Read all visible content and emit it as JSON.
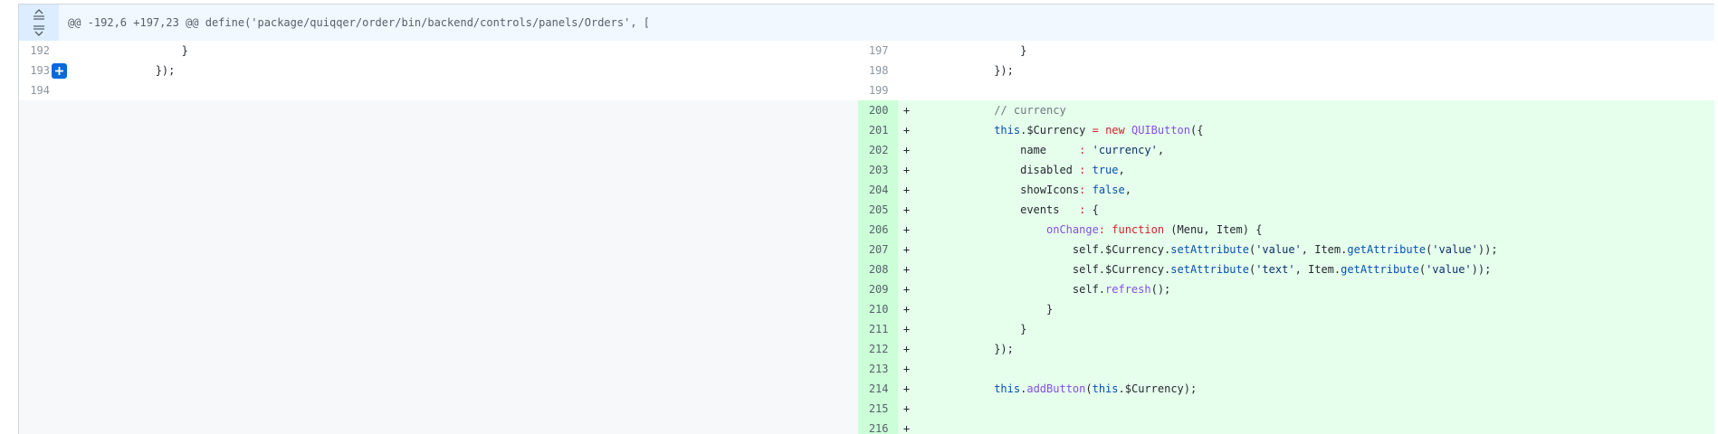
{
  "hunk": {
    "header": "@@ -192,6 +197,23 @@ define('package/quiqqer/order/bin/backend/controls/panels/Orders', ["
  },
  "icons": {
    "expand_up": "expand-up-icon",
    "expand_down": "expand-down-icon",
    "add_comment": "plus-icon"
  },
  "colors": {
    "added_bg": "#e6ffec",
    "added_num_bg": "#ccffd8",
    "hunk_bg": "#f1f8ff",
    "accent": "#0969da"
  },
  "context_rows": [
    {
      "left_num": "192",
      "left_code": "                }",
      "right_num": "197",
      "right_code": "                }"
    },
    {
      "left_num": "193",
      "left_code": "            });",
      "right_num": "198",
      "right_code": "            });"
    },
    {
      "left_num": "194",
      "left_code": "",
      "right_num": "199",
      "right_code": ""
    }
  ],
  "added_rows": [
    {
      "num": "200",
      "marker": "+",
      "code": [
        {
          "t": "            "
        },
        {
          "t": "// currency",
          "c": "cm"
        }
      ]
    },
    {
      "num": "201",
      "marker": "+",
      "code": [
        {
          "t": "            "
        },
        {
          "t": "this",
          "c": "this"
        },
        {
          "t": ".$Currency "
        },
        {
          "t": "=",
          "c": "kw"
        },
        {
          "t": " "
        },
        {
          "t": "new",
          "c": "kw"
        },
        {
          "t": " "
        },
        {
          "t": "QUIButton",
          "c": "fn"
        },
        {
          "t": "({"
        }
      ]
    },
    {
      "num": "202",
      "marker": "+",
      "code": [
        {
          "t": "                name     "
        },
        {
          "t": ":",
          "c": "kw"
        },
        {
          "t": " "
        },
        {
          "t": "'currency'",
          "c": "str"
        },
        {
          "t": ","
        }
      ]
    },
    {
      "num": "203",
      "marker": "+",
      "code": [
        {
          "t": "                disabled "
        },
        {
          "t": ":",
          "c": "kw"
        },
        {
          "t": " "
        },
        {
          "t": "true",
          "c": "bool"
        },
        {
          "t": ","
        }
      ]
    },
    {
      "num": "204",
      "marker": "+",
      "code": [
        {
          "t": "                showIcons"
        },
        {
          "t": ":",
          "c": "kw"
        },
        {
          "t": " "
        },
        {
          "t": "false",
          "c": "bool"
        },
        {
          "t": ","
        }
      ]
    },
    {
      "num": "205",
      "marker": "+",
      "code": [
        {
          "t": "                events   "
        },
        {
          "t": ":",
          "c": "kw"
        },
        {
          "t": " {"
        }
      ]
    },
    {
      "num": "206",
      "marker": "+",
      "code": [
        {
          "t": "                    "
        },
        {
          "t": "onChange",
          "c": "prop"
        },
        {
          "t": ": ",
          "c": "kw"
        },
        {
          "t": "function",
          "c": "kw"
        },
        {
          "t": " (Menu, Item) {"
        }
      ]
    },
    {
      "num": "207",
      "marker": "+",
      "code": [
        {
          "t": "                        self.$Currency."
        },
        {
          "t": "setAttribute",
          "c": "this"
        },
        {
          "t": "("
        },
        {
          "t": "'value'",
          "c": "str"
        },
        {
          "t": ", Item."
        },
        {
          "t": "getAttribute",
          "c": "this"
        },
        {
          "t": "("
        },
        {
          "t": "'value'",
          "c": "str"
        },
        {
          "t": "));"
        }
      ]
    },
    {
      "num": "208",
      "marker": "+",
      "code": [
        {
          "t": "                        self.$Currency."
        },
        {
          "t": "setAttribute",
          "c": "this"
        },
        {
          "t": "("
        },
        {
          "t": "'text'",
          "c": "str"
        },
        {
          "t": ", Item."
        },
        {
          "t": "getAttribute",
          "c": "this"
        },
        {
          "t": "("
        },
        {
          "t": "'value'",
          "c": "str"
        },
        {
          "t": "));"
        }
      ]
    },
    {
      "num": "209",
      "marker": "+",
      "code": [
        {
          "t": "                        self."
        },
        {
          "t": "refresh",
          "c": "fn"
        },
        {
          "t": "();"
        }
      ]
    },
    {
      "num": "210",
      "marker": "+",
      "code": [
        {
          "t": "                    }"
        }
      ]
    },
    {
      "num": "211",
      "marker": "+",
      "code": [
        {
          "t": "                }"
        }
      ]
    },
    {
      "num": "212",
      "marker": "+",
      "code": [
        {
          "t": "            });"
        }
      ]
    },
    {
      "num": "213",
      "marker": "+",
      "code": [
        {
          "t": ""
        }
      ]
    },
    {
      "num": "214",
      "marker": "+",
      "code": [
        {
          "t": "            "
        },
        {
          "t": "this",
          "c": "this"
        },
        {
          "t": "."
        },
        {
          "t": "addButton",
          "c": "fn"
        },
        {
          "t": "("
        },
        {
          "t": "this",
          "c": "this"
        },
        {
          "t": ".$Currency);"
        }
      ]
    },
    {
      "num": "215",
      "marker": "+",
      "code": [
        {
          "t": ""
        }
      ]
    },
    {
      "num": "216",
      "marker": "+",
      "code": [
        {
          "t": ""
        }
      ]
    }
  ]
}
